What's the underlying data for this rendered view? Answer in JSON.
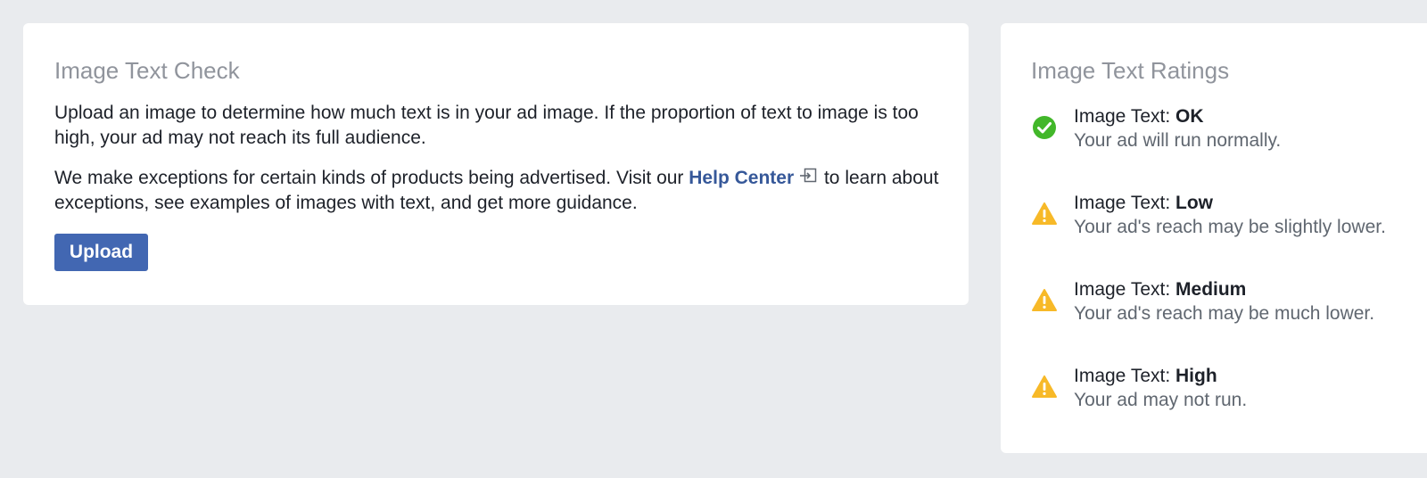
{
  "check": {
    "title": "Image Text Check",
    "paragraph1": "Upload an image to determine how much text is in your ad image. If the proportion of text to image is too high, your ad may not reach its full audience.",
    "paragraph2_before": "We make exceptions for certain kinds of products being advertised. Visit our",
    "help_link": "Help Center",
    "paragraph2_after": "to learn about exceptions, see examples of images with text, and get more guidance.",
    "upload_label": "Upload"
  },
  "ratings": {
    "title": "Image Text Ratings",
    "prefix": "Image Text:",
    "items": [
      {
        "level": "OK",
        "description": "Your ad will run normally.",
        "icon": "check-circle-icon"
      },
      {
        "level": "Low",
        "description": "Your ad's reach may be slightly lower.",
        "icon": "warning-icon"
      },
      {
        "level": "Medium",
        "description": "Your ad's reach may be much lower.",
        "icon": "warning-icon"
      },
      {
        "level": "High",
        "description": "Your ad may not run.",
        "icon": "warning-icon"
      }
    ]
  },
  "colors": {
    "background": "#e9ebee",
    "card": "#ffffff",
    "title": "#90949c",
    "link": "#365899",
    "button": "#4267b2",
    "ok_green": "#42b72a",
    "warning_yellow": "#f7b928"
  }
}
